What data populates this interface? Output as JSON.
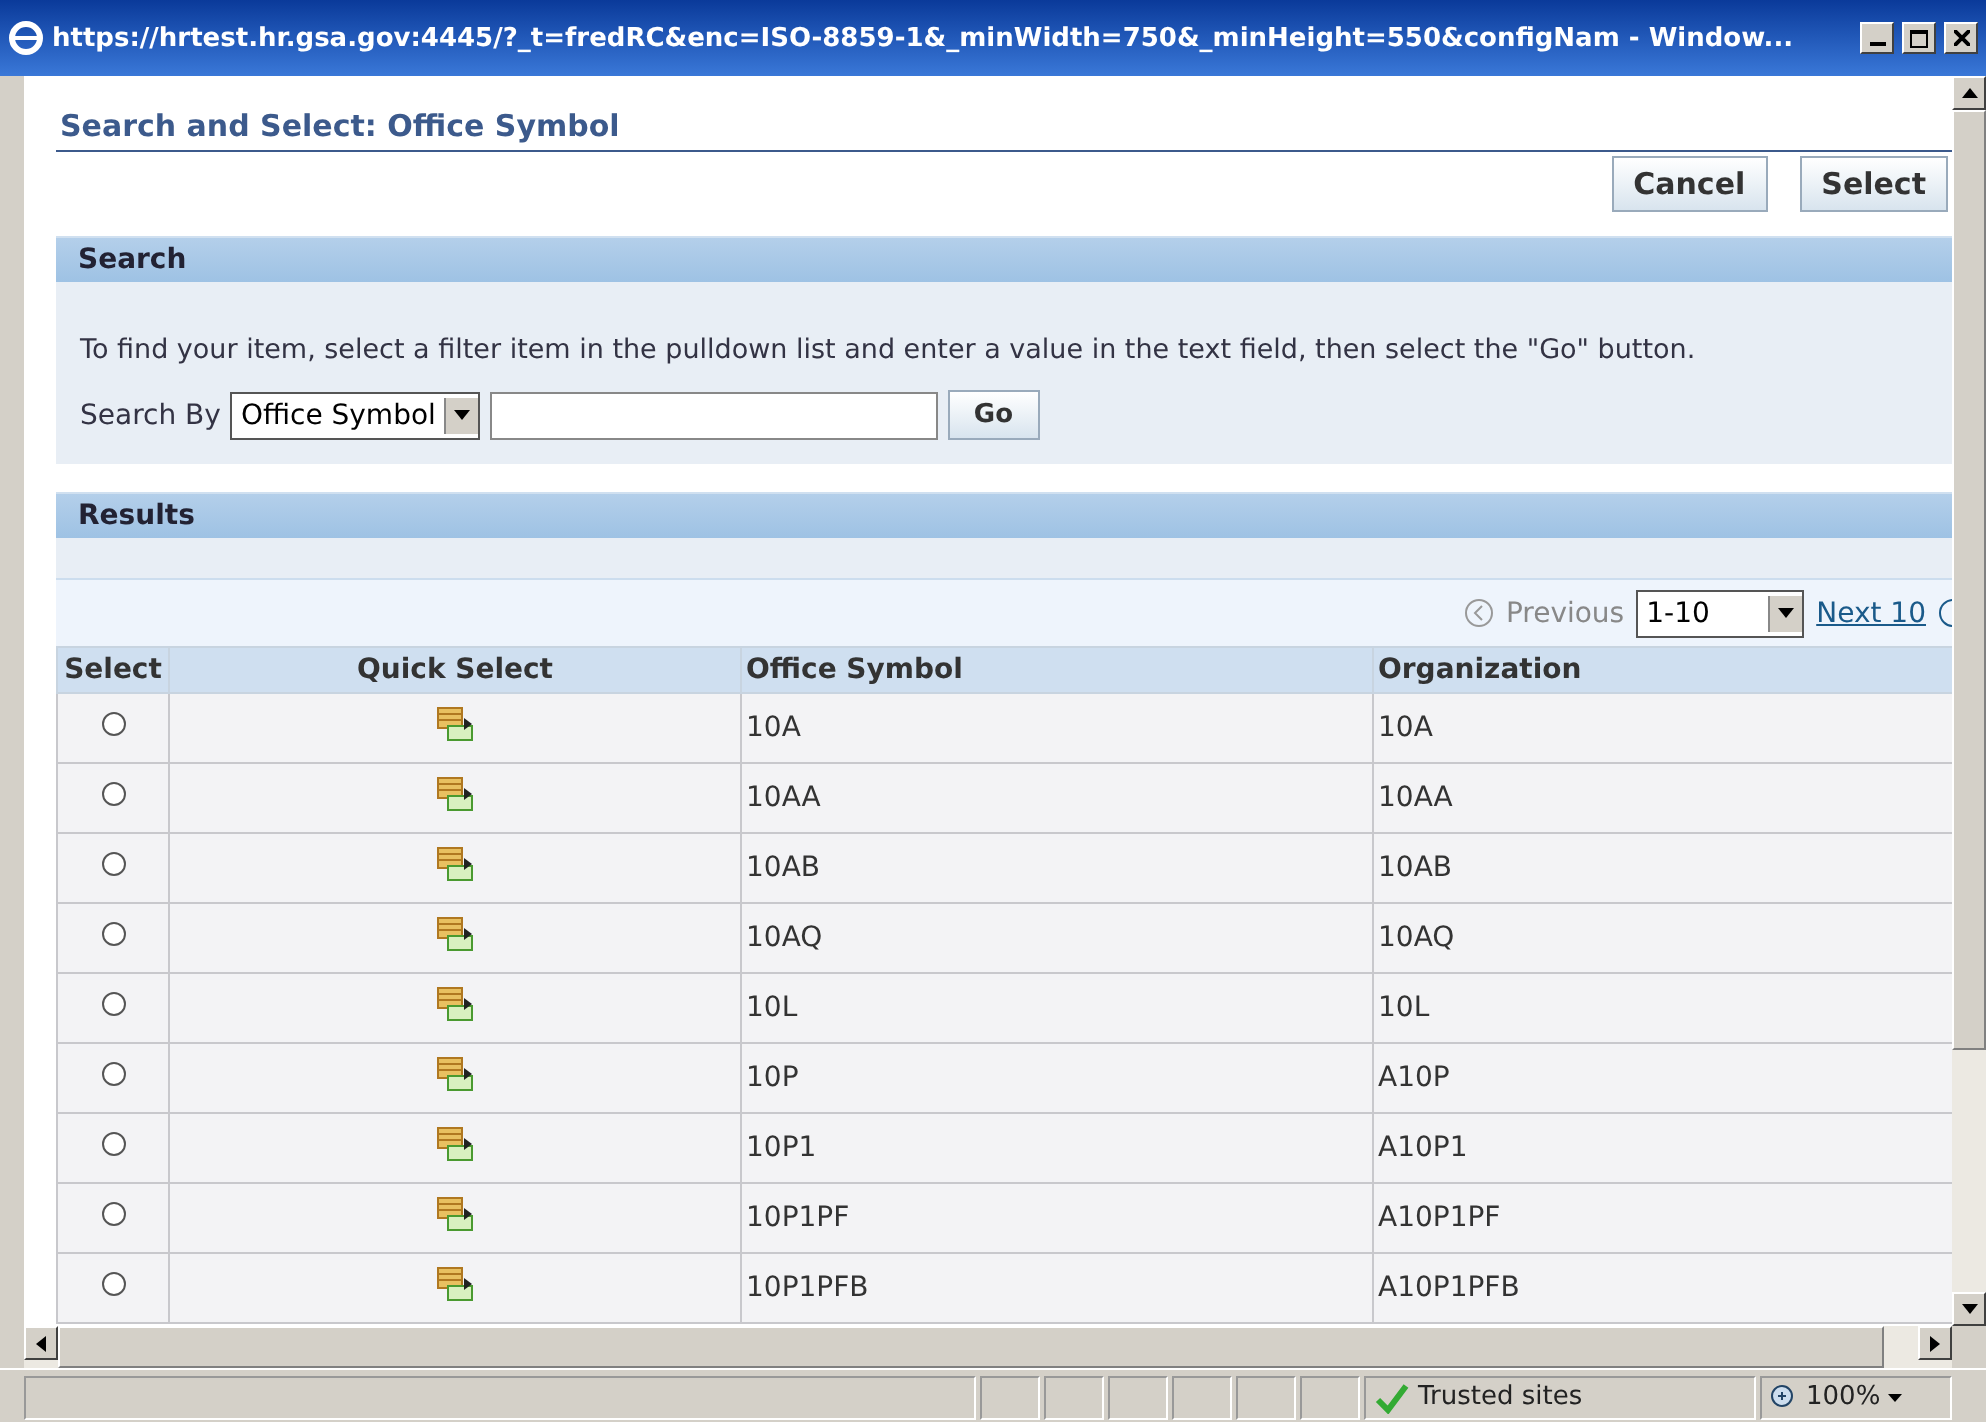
{
  "window": {
    "title": "https://hrtest.hr.gsa.gov:4445/?_t=fredRC&enc=ISO-8859-1&_minWidth=750&_minHeight=550&configNam - Window..."
  },
  "page_title": "Search and Select: Office Symbol",
  "buttons": [
    "Cancel",
    "Select"
  ],
  "search": {
    "header": "Search",
    "instructions": "To find your item, select a filter item in the pulldown list and enter a value in the text field, then select the \"Go\" button.",
    "search_by_label": "Search By",
    "filter": "Office Symbol",
    "go": "Go"
  },
  "results": {
    "header": "Results",
    "previous": "Previous",
    "range": "1-10",
    "next": "Next 10",
    "columns": [
      "Select",
      "Quick Select",
      "Office Symbol",
      "Organization"
    ],
    "rows": [
      {
        "selected": false,
        "office_symbol": "10A",
        "organization": "10A"
      },
      {
        "selected": false,
        "office_symbol": "10AA",
        "organization": "10AA"
      },
      {
        "selected": false,
        "office_symbol": "10AB",
        "organization": "10AB"
      },
      {
        "selected": false,
        "office_symbol": "10AQ",
        "organization": "10AQ"
      },
      {
        "selected": false,
        "office_symbol": "10L",
        "organization": "10L"
      },
      {
        "selected": false,
        "office_symbol": "10P",
        "organization": "A10P"
      },
      {
        "selected": false,
        "office_symbol": "10P1",
        "organization": "A10P1"
      },
      {
        "selected": false,
        "office_symbol": "10P1PF",
        "organization": "A10P1PF"
      },
      {
        "selected": false,
        "office_symbol": "10P1PFB",
        "organization": "A10P1PFB"
      }
    ]
  },
  "status_bar": {
    "zone": "Trusted sites",
    "zoom": "100%"
  }
}
